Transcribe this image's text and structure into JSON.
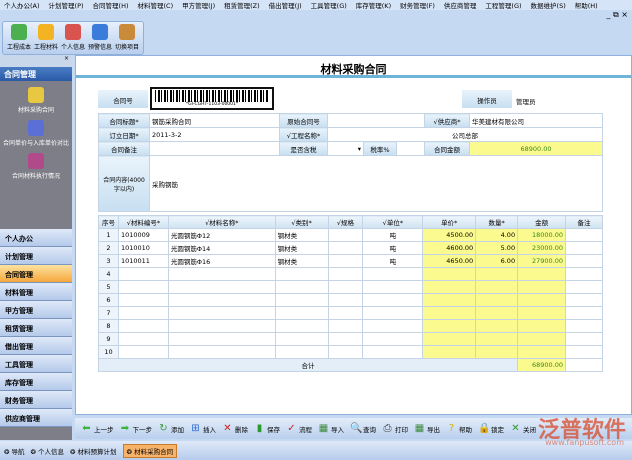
{
  "menu": [
    "个人办公(A)",
    "计划管理(P)",
    "合同管理(H)",
    "材料管理(C)",
    "甲方管理(J)",
    "租赁管理(Z)",
    "借出管理(J)",
    "工具管理(G)",
    "库存管理(K)",
    "财务管理(F)",
    "供应商管理",
    "工程管理(G)",
    "数据维护(S)",
    "帮助(H)"
  ],
  "window_controls": "_ ⧉ ×",
  "ribbon": [
    "工程成本",
    "工程材料",
    "个人信息",
    "预警信息",
    "切换项目"
  ],
  "sidebar": {
    "title": "合同管理",
    "items": [
      "材料采购合同",
      "合同单价与入库单价对比",
      "合同材料执行情况"
    ],
    "nav": [
      "个人办公",
      "计划管理",
      "合同管理",
      "材料管理",
      "甲方管理",
      "租赁管理",
      "借出管理",
      "工具管理",
      "库存管理",
      "财务管理",
      "供应商管理"
    ]
  },
  "page_title": "材料采购合同",
  "form": {
    "contract_no_label": "合同号",
    "barcode_text": "*GI-CGHT-1103-00001*",
    "operator_label": "操作员",
    "operator": "管理员",
    "title_label": "合同标题*",
    "title": "钢筋采购合同",
    "orig_no_label": "原始合同号",
    "orig_no": "",
    "supplier_label": "√供应商*",
    "supplier": "华美建材有限公司",
    "date_label": "订立日期*",
    "date": "2011-3-2",
    "project_label": "√工程名称*",
    "project": "公司总部",
    "remark_label": "合同备注",
    "remark": "",
    "tax_label": "是否含税",
    "tax": "",
    "rate_label": "税率%",
    "rate": "",
    "amount_label": "合同金额",
    "amount": "68900.00",
    "content_label": "合同内容(4000字以内)",
    "content": "采购钢筋"
  },
  "grid": {
    "headers": [
      "序号",
      "√材料编号*",
      "√材料名称*",
      "√类别*",
      "√规格",
      "√单位*",
      "单价*",
      "数量*",
      "金额",
      "备注"
    ],
    "rows": [
      [
        "1",
        "1010009",
        "光圆钢筋Φ12",
        "钢材类",
        "",
        "吨",
        "4500.00",
        "4.00",
        "18000.00",
        ""
      ],
      [
        "2",
        "1010010",
        "光圆钢筋Φ14",
        "钢材类",
        "",
        "吨",
        "4600.00",
        "5.00",
        "23000.00",
        ""
      ],
      [
        "3",
        "1010011",
        "光圆钢筋Φ16",
        "钢材类",
        "",
        "吨",
        "4650.00",
        "6.00",
        "27900.00",
        ""
      ],
      [
        "4",
        "",
        "",
        "",
        "",
        "",
        "",
        "",
        "",
        ""
      ],
      [
        "5",
        "",
        "",
        "",
        "",
        "",
        "",
        "",
        "",
        ""
      ],
      [
        "6",
        "",
        "",
        "",
        "",
        "",
        "",
        "",
        "",
        ""
      ],
      [
        "7",
        "",
        "",
        "",
        "",
        "",
        "",
        "",
        "",
        ""
      ],
      [
        "8",
        "",
        "",
        "",
        "",
        "",
        "",
        "",
        "",
        ""
      ],
      [
        "9",
        "",
        "",
        "",
        "",
        "",
        "",
        "",
        "",
        ""
      ],
      [
        "10",
        "",
        "",
        "",
        "",
        "",
        "",
        "",
        "",
        ""
      ]
    ],
    "total_label": "合计",
    "total": "68900.00"
  },
  "toolbar": [
    "上一步",
    "下一步",
    "添加",
    "插入",
    "删除",
    "保存",
    "流程",
    "导入",
    "查询",
    "打印",
    "导出",
    "帮助",
    "锁定",
    "关闭"
  ],
  "taskbar": [
    "导航",
    "个人信息",
    "材料预算计划",
    "材料采购合同"
  ],
  "watermark": "泛普软件",
  "watermark_url": "www.fanpusoft.com"
}
